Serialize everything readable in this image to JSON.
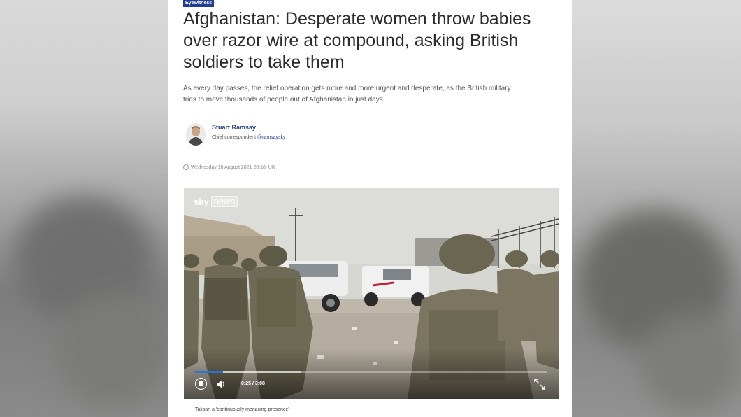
{
  "article": {
    "tag": "Eyewitness",
    "headline": "Afghanistan: Desperate women throw babies over razor wire at compound, asking British soldiers to take them",
    "standfirst": "As every day passes, the relief operation gets more and more urgent and desperate, as the British military tries to move thousands of people out of Afghanistan in just days.",
    "author": {
      "name": "Stuart Ramsay",
      "role": "Chief correspondent",
      "handle": "@ramsaysky"
    },
    "date": "Wednesday 18 August 2021 20:18, UK"
  },
  "video": {
    "logo_main": "sky",
    "logo_sub": "news",
    "timecode": "0:25 / 3:08",
    "progress_played": 0.08,
    "progress_buffered": 0.3,
    "caption": "Taliban a 'continuously menacing presence'"
  },
  "colors": {
    "accent": "#1f3d93",
    "progress": "#2e6fd8"
  },
  "icons": [
    "clock-icon",
    "pause-icon",
    "volume-icon",
    "fullscreen-icon",
    "avatar"
  ]
}
